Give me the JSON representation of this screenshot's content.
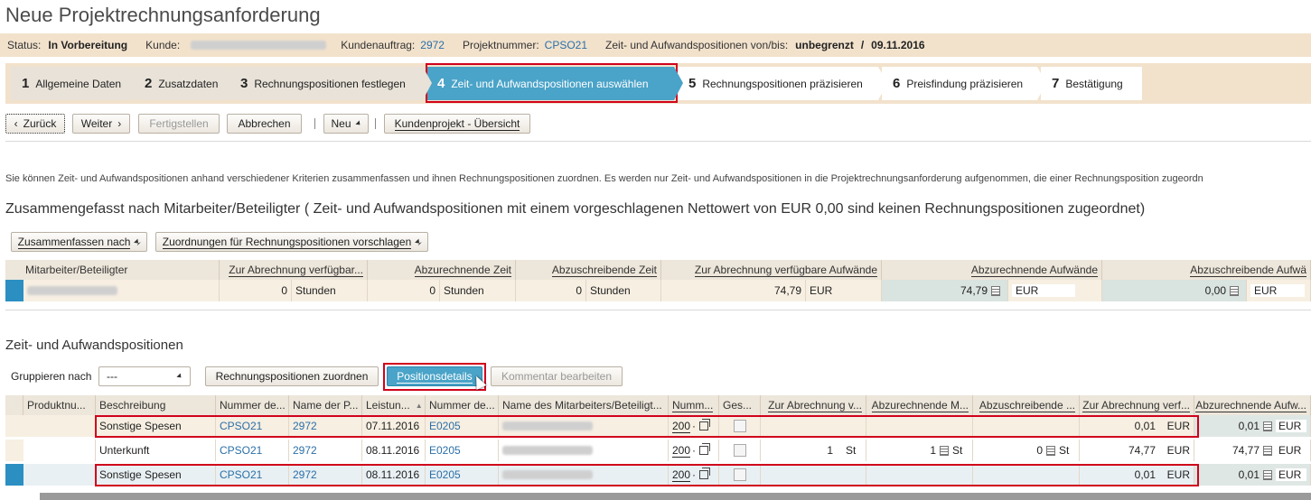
{
  "title": "Neue Projektrechnungsanforderung",
  "status": {
    "status_label": "Status:",
    "status_value": "In Vorbereitung",
    "kunde_label": "Kunde:",
    "auftrag_label": "Kundenauftrag:",
    "auftrag_value": "2972",
    "projekt_label": "Projektnummer:",
    "projekt_value": "CPSO21",
    "zeitraum_label": "Zeit- und Aufwandspositionen von/bis:",
    "zeitraum_von": "unbegrenzt",
    "zeitraum_sep": "/",
    "zeitraum_bis": "09.11.2016"
  },
  "roadmap": [
    {
      "num": "1",
      "label": "Allgemeine Daten"
    },
    {
      "num": "2",
      "label": "Zusatzdaten"
    },
    {
      "num": "3",
      "label": "Rechnungspositionen festlegen"
    },
    {
      "num": "4",
      "label": "Zeit- und Aufwandspositionen auswählen"
    },
    {
      "num": "5",
      "label": "Rechnungspositionen präzisieren"
    },
    {
      "num": "6",
      "label": "Preisfindung präzisieren"
    },
    {
      "num": "7",
      "label": "Bestätigung"
    }
  ],
  "toolbar": {
    "back": "Zurück",
    "next": "Weiter",
    "finish": "Fertigstellen",
    "cancel": "Abbrechen",
    "new": "Neu",
    "overview": "Kundenprojekt - Übersicht"
  },
  "info_text": "Sie können Zeit- und Aufwandspositionen anhand verschiedener Kriterien zusammenfassen und ihnen Rechnungspositionen zuordnen. Es werden nur Zeit- und Aufwandspositionen in die Projektrechnungsanforderung aufgenommen, die einer Rechnungsposition zugeordn",
  "summary": {
    "title": "Zusammengefasst nach Mitarbeiter/Beteiligter ( Zeit- und Aufwandspositionen mit einem vorgeschlagenen Nettowert von EUR 0,00 sind keinen Rechnungspositionen zugeordnet)",
    "btn_group": "Zusammenfassen nach",
    "btn_suggest": "Zuordnungen für Rechnungspositionen vorschlagen",
    "headers": [
      "Mitarbeiter/Beteiligter",
      "Zur Abrechnung verfügbar...",
      "Abzurechnende Zeit",
      "Abzuschreibende Zeit",
      "Zur Abrechnung verfügbare Aufwände",
      "Abzurechnende Aufwände",
      "Abzuschreibende Aufwä"
    ],
    "row": {
      "avail_time": "0",
      "avail_unit": "Stunden",
      "bill_time": "0",
      "bill_unit": "Stunden",
      "wo_time": "0",
      "wo_unit": "Stunden",
      "avail_exp": "74,79",
      "avail_cur": "EUR",
      "bill_exp": "74,79",
      "bill_cur": "EUR",
      "wo_exp": "0,00",
      "wo_cur": "EUR"
    }
  },
  "items": {
    "title": "Zeit- und Aufwandspositionen",
    "group_label": "Gruppieren nach",
    "group_value": "---",
    "btn_assign": "Rechnungspositionen zuordnen",
    "btn_details": "Positionsdetails",
    "btn_comment": "Kommentar bearbeiten",
    "headers": [
      "Produktnu...",
      "Beschreibung",
      "Nummer de...",
      "Name der P...",
      "Leistun...",
      "Nummer de...",
      "Name des Mitarbeiters/Beteiligt...",
      "Numm...",
      "Ges...",
      "Zur Abrechnung v...",
      "Abzurechnende M...",
      "Abzuschreibende ...",
      "Zur Abrechnung verf...",
      "Abzurechnende Aufw..."
    ],
    "rows": [
      {
        "desc": "Sonstige Spesen",
        "proj": "CPSO21",
        "order": "2972",
        "date": "07.11.2016",
        "emp": "E0205",
        "num": "200",
        "qty": "",
        "qty_unit": "",
        "bqty": "",
        "bqty_unit": "",
        "wqty": "",
        "wqty_unit": "",
        "avail": "0,01",
        "avail_cur": "EUR",
        "bill": "0,01",
        "bill_cur": "EUR"
      },
      {
        "desc": "Unterkunft",
        "proj": "CPSO21",
        "order": "2972",
        "date": "08.11.2016",
        "emp": "E0205",
        "num": "200",
        "qty": "1",
        "qty_unit": "St",
        "bqty": "1",
        "bqty_unit": "St",
        "wqty": "0",
        "wqty_unit": "St",
        "avail": "74,77",
        "avail_cur": "EUR",
        "bill": "74,77",
        "bill_cur": "EUR"
      },
      {
        "desc": "Sonstige Spesen",
        "proj": "CPSO21",
        "order": "2972",
        "date": "08.11.2016",
        "emp": "E0205",
        "num": "200",
        "qty": "",
        "qty_unit": "",
        "bqty": "",
        "bqty_unit": "",
        "wqty": "",
        "wqty_unit": "",
        "avail": "0,01",
        "avail_cur": "EUR",
        "bill": "0,01",
        "bill_cur": "EUR"
      }
    ]
  },
  "colors": {
    "accent": "#4aa3c8",
    "highlight": "#d0021b",
    "link": "#2a6fa8",
    "bar": "#f2e2cc"
  }
}
